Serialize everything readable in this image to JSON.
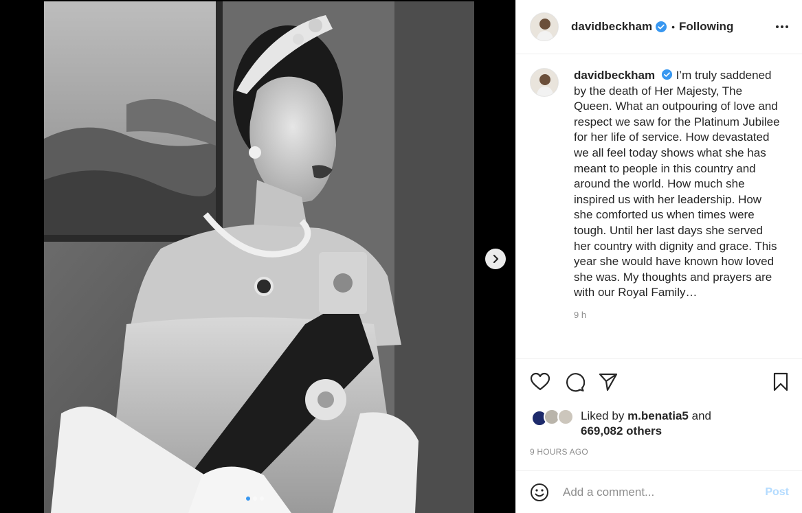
{
  "post": {
    "author": "davidbeckham",
    "follow_status": "Following",
    "separator": "•",
    "caption": "I’m truly saddened by the death of Her Majesty, The Queen. What an outpouring of love and respect we saw for the Platinum Jubilee for her life of service. How devastated we all feel today shows what she has meant to people in this country and around the world. How much she inspired us with her leadership. How she comforted us when times were tough. Until her last days she served her country with dignity and grace. This year she would have known how loved she was. My thoughts and prayers are with our Royal Family…",
    "caption_time": "9 h",
    "liked_by_prefix": "Liked by",
    "liked_by_user": "m.benatia5",
    "liked_by_and": "and",
    "likes_others": "669,082 others",
    "posted_ago": "9 HOURS AGO"
  },
  "carousel": {
    "total_slides": 3,
    "current_slide": 1
  },
  "comment": {
    "placeholder": "Add a comment...",
    "post_label": "Post"
  },
  "icons": {
    "verified": "verified-badge-icon",
    "more": "more-options-icon",
    "like": "heart-icon",
    "comment": "comment-icon",
    "share": "paper-plane-icon",
    "save": "bookmark-icon",
    "emoji": "emoji-icon",
    "next": "chevron-right-icon"
  },
  "colors": {
    "verified_blue": "#3897f0",
    "post_button": "#b3dbff",
    "secondary_text": "#8e8e8e",
    "primary_text": "#262626"
  }
}
